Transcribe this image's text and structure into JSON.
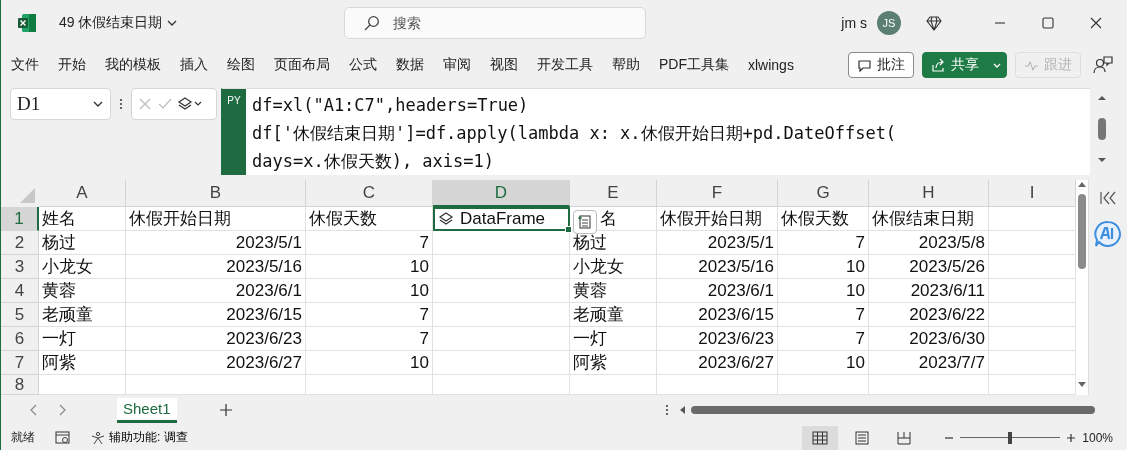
{
  "window": {
    "title": "49 休假结束日期",
    "user": "jm s",
    "avatar": "JS"
  },
  "search": {
    "placeholder": "搜索"
  },
  "ribbon_tabs": [
    {
      "label": "文件"
    },
    {
      "label": "开始"
    },
    {
      "label": "我的模板"
    },
    {
      "label": "插入"
    },
    {
      "label": "绘图"
    },
    {
      "label": "页面布局"
    },
    {
      "label": "公式"
    },
    {
      "label": "数据"
    },
    {
      "label": "审阅"
    },
    {
      "label": "视图"
    },
    {
      "label": "开发工具"
    },
    {
      "label": "帮助"
    },
    {
      "label": "PDF工具集"
    },
    {
      "label": "xlwings"
    }
  ],
  "ribbon_buttons": [
    {
      "kind": "comment",
      "label": "批注",
      "disabled": false
    },
    {
      "kind": "share",
      "label": "共享",
      "disabled": false
    },
    {
      "kind": "follow",
      "label": "跟进",
      "disabled": true
    }
  ],
  "formula_bar": {
    "name_box": "D1",
    "badge": "PY",
    "lines": [
      "df=xl(\"A1:C7\",headers=True)",
      "df['休假结束日期']=df.apply(lambda x: x.休假开始日期+pd.DateOffset(",
      "days=x.休假天数), axis=1)"
    ]
  },
  "sheet": {
    "columns": [
      {
        "label": "A",
        "selected": false
      },
      {
        "label": "B",
        "selected": false
      },
      {
        "label": "C",
        "selected": false
      },
      {
        "label": "D",
        "selected": true
      },
      {
        "label": "E",
        "selected": false
      },
      {
        "label": "F",
        "selected": false
      },
      {
        "label": "G",
        "selected": false
      },
      {
        "label": "H",
        "selected": false
      },
      {
        "label": "I",
        "selected": false
      }
    ],
    "rows": [
      {
        "number": "1",
        "selected": true,
        "cells": [
          {
            "kind": "text",
            "text": "姓名"
          },
          {
            "kind": "text",
            "text": "休假开始日期"
          },
          {
            "kind": "text",
            "text": "休假天数"
          },
          {
            "kind": "python",
            "text": "DataFrame",
            "selected": true
          },
          {
            "kind": "covered",
            "text": "名"
          },
          {
            "kind": "text",
            "text": "休假开始日期"
          },
          {
            "kind": "text",
            "text": "休假天数"
          },
          {
            "kind": "text",
            "text": "休假结束日期"
          },
          null
        ]
      },
      {
        "number": "2",
        "selected": false,
        "cells": [
          {
            "kind": "text",
            "text": "杨过"
          },
          {
            "kind": "number",
            "text": "2023/5/1"
          },
          {
            "kind": "number",
            "text": "7"
          },
          null,
          {
            "kind": "text",
            "text": "杨过"
          },
          {
            "kind": "number",
            "text": "2023/5/1"
          },
          {
            "kind": "number",
            "text": "7"
          },
          {
            "kind": "number",
            "text": "2023/5/8"
          },
          null
        ]
      },
      {
        "number": "3",
        "selected": false,
        "cells": [
          {
            "kind": "text",
            "text": "小龙女"
          },
          {
            "kind": "number",
            "text": "2023/5/16"
          },
          {
            "kind": "number",
            "text": "10"
          },
          null,
          {
            "kind": "text",
            "text": "小龙女"
          },
          {
            "kind": "number",
            "text": "2023/5/16"
          },
          {
            "kind": "number",
            "text": "10"
          },
          {
            "kind": "number",
            "text": "2023/5/26"
          },
          null
        ]
      },
      {
        "number": "4",
        "selected": false,
        "cells": [
          {
            "kind": "text",
            "text": "黄蓉"
          },
          {
            "kind": "number",
            "text": "2023/6/1"
          },
          {
            "kind": "number",
            "text": "10"
          },
          null,
          {
            "kind": "text",
            "text": "黄蓉"
          },
          {
            "kind": "number",
            "text": "2023/6/1"
          },
          {
            "kind": "number",
            "text": "10"
          },
          {
            "kind": "number",
            "text": "2023/6/11"
          },
          null
        ]
      },
      {
        "number": "5",
        "selected": false,
        "cells": [
          {
            "kind": "text",
            "text": "老顽童"
          },
          {
            "kind": "number",
            "text": "2023/6/15"
          },
          {
            "kind": "number",
            "text": "7"
          },
          null,
          {
            "kind": "text",
            "text": "老顽童"
          },
          {
            "kind": "number",
            "text": "2023/6/15"
          },
          {
            "kind": "number",
            "text": "7"
          },
          {
            "kind": "number",
            "text": "2023/6/22"
          },
          null
        ]
      },
      {
        "number": "6",
        "selected": false,
        "cells": [
          {
            "kind": "text",
            "text": "一灯"
          },
          {
            "kind": "number",
            "text": "2023/6/23"
          },
          {
            "kind": "number",
            "text": "7"
          },
          null,
          {
            "kind": "text",
            "text": "一灯"
          },
          {
            "kind": "number",
            "text": "2023/6/23"
          },
          {
            "kind": "number",
            "text": "7"
          },
          {
            "kind": "number",
            "text": "2023/6/30"
          },
          null
        ]
      },
      {
        "number": "7",
        "selected": false,
        "cells": [
          {
            "kind": "text",
            "text": "阿紫"
          },
          {
            "kind": "number",
            "text": "2023/6/27"
          },
          {
            "kind": "number",
            "text": "10"
          },
          null,
          {
            "kind": "text",
            "text": "阿紫"
          },
          {
            "kind": "number",
            "text": "2023/6/27"
          },
          {
            "kind": "number",
            "text": "10"
          },
          {
            "kind": "number",
            "text": "2023/7/7"
          },
          null
        ]
      },
      {
        "number": "8",
        "selected": false,
        "cells": [
          null,
          null,
          null,
          null,
          null,
          null,
          null,
          null,
          null
        ]
      }
    ]
  },
  "sheet_tabs": [
    {
      "label": "Sheet1",
      "selected": true
    }
  ],
  "status_bar": {
    "status": "就绪",
    "accessibility": "辅助功能: 调查",
    "views": [
      {
        "kind": "normal",
        "selected": true
      },
      {
        "kind": "layout",
        "selected": false
      },
      {
        "kind": "break",
        "selected": false
      }
    ],
    "zoom": {
      "level": 0.5,
      "reading": "100%"
    }
  }
}
